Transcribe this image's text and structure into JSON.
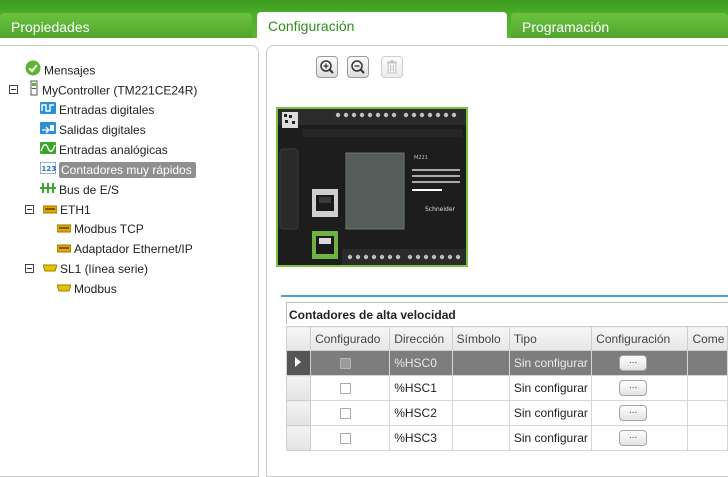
{
  "tabs": [
    {
      "label": "Propiedades"
    },
    {
      "label": "Configuración"
    },
    {
      "label": "Programación"
    }
  ],
  "tree": {
    "mensajes": "Mensajes",
    "controller": "MyController  (TM221CE24R)",
    "entradas_digitales": "Entradas digitales",
    "salidas_digitales": "Salidas digitales",
    "entradas_analogicas": "Entradas analógicas",
    "contadores": "Contadores muy rápidos",
    "bus": "Bus de E/S",
    "eth1": "ETH1",
    "modbus_tcp": "Modbus TCP",
    "adaptador": "Adaptador Ethernet/IP",
    "sl1": "SL1 (línea serie)",
    "modbus": "Modbus"
  },
  "device": {
    "model": "M221",
    "brand": "Schneider"
  },
  "grid": {
    "title": "Contadores de alta velocidad",
    "headers": [
      "Configurado",
      "Dirección",
      "Símbolo",
      "Tipo",
      "Configuración",
      "Come"
    ],
    "button_label": "...",
    "rows": [
      {
        "address": "%HSC0",
        "symbol": "",
        "type": "Sin configurar"
      },
      {
        "address": "%HSC1",
        "symbol": "",
        "type": "Sin configurar"
      },
      {
        "address": "%HSC2",
        "symbol": "",
        "type": "Sin configurar"
      },
      {
        "address": "%HSC3",
        "symbol": "",
        "type": "Sin configurar"
      }
    ]
  },
  "colors": {
    "brand_green": "#4caf2a",
    "selection_gray": "#8f8f8f",
    "accent_blue": "#4aa3d8"
  }
}
